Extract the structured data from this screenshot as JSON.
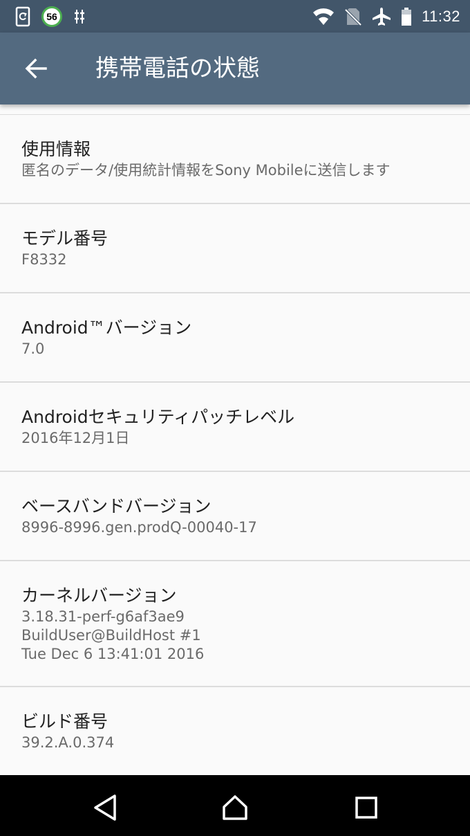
{
  "status_bar": {
    "notification_count": "56",
    "time": "11:32"
  },
  "toolbar": {
    "title": "携帯電話の状態"
  },
  "items": [
    {
      "title": "使用情報",
      "subtitle": "匿名のデータ/使用統計情報をSony Mobileに送信します"
    },
    {
      "title": "モデル番号",
      "subtitle": "F8332"
    },
    {
      "title": "Android™バージョン",
      "subtitle": "7.0"
    },
    {
      "title": "Androidセキュリティパッチレベル",
      "subtitle": "2016年12月1日"
    },
    {
      "title": "ベースバンドバージョン",
      "subtitle": "8996-8996.gen.prodQ-00040-17"
    },
    {
      "title": "カーネルバージョン",
      "subtitle": "3.18.31-perf-g6af3ae9\nBuildUser@BuildHost #1\nTue Dec 6 13:41:01 2016"
    },
    {
      "title": "ビルド番号",
      "subtitle": "39.2.A.0.374"
    }
  ],
  "colors": {
    "status_bar": "#42566a",
    "toolbar": "#536a80",
    "background": "#fafafa",
    "divider": "#dcdcdc",
    "badge_ring": "#4caf50"
  }
}
